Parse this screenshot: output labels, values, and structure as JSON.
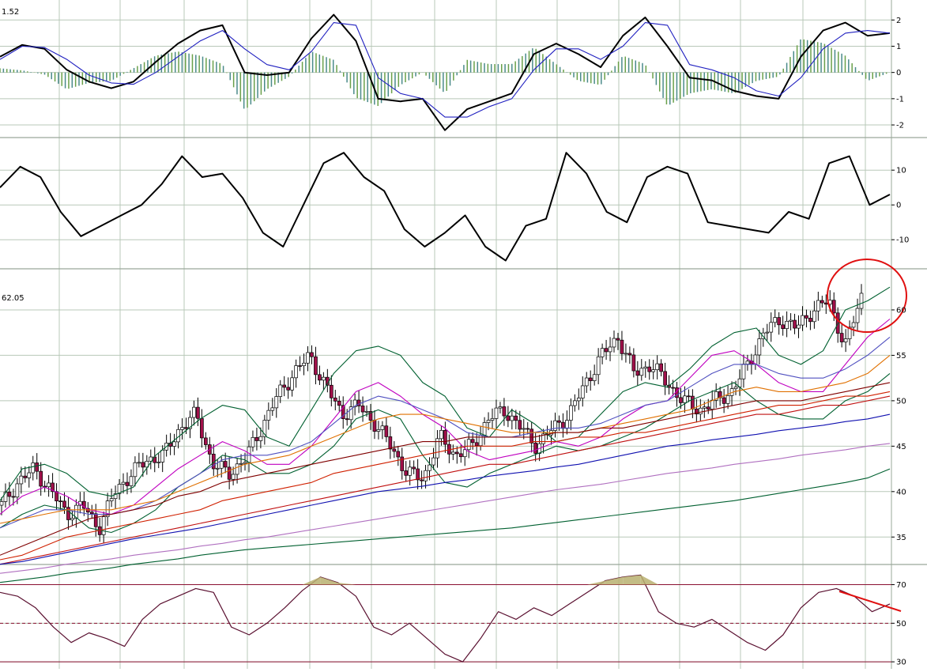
{
  "chart_data": [
    {
      "type": "line",
      "panel": "macd",
      "readout": "1.52",
      "yticks": [
        2,
        1,
        0,
        -1,
        -2
      ],
      "ylim": [
        -2.3,
        2.4
      ],
      "series": [
        {
          "kind": "macd",
          "color": "#000000",
          "values": [
            0.6,
            1.05,
            0.9,
            0.1,
            -0.35,
            -0.6,
            -0.35,
            0.4,
            1.1,
            1.6,
            1.8,
            0.0,
            -0.1,
            0.0,
            1.3,
            2.2,
            1.2,
            -1.0,
            -1.1,
            -1.0,
            -2.2,
            -1.4,
            -1.1,
            -0.8,
            0.7,
            1.1,
            0.7,
            0.2,
            1.4,
            2.1,
            1.0,
            -0.2,
            -0.3,
            -0.7,
            -0.9,
            -1.0,
            0.6,
            1.6,
            1.9,
            1.4,
            1.5
          ]
        },
        {
          "kind": "signal",
          "color": "#2020c0",
          "values": [
            0.5,
            1.0,
            0.95,
            0.5,
            -0.1,
            -0.4,
            -0.45,
            0.0,
            0.6,
            1.2,
            1.6,
            0.9,
            0.3,
            0.1,
            0.8,
            1.9,
            1.8,
            -0.2,
            -0.8,
            -1.0,
            -1.7,
            -1.7,
            -1.3,
            -1.0,
            0.1,
            0.9,
            0.9,
            0.5,
            1.0,
            1.9,
            1.8,
            0.3,
            0.1,
            -0.2,
            -0.7,
            -0.9,
            -0.2,
            0.9,
            1.5,
            1.6,
            1.5
          ]
        }
      ]
    },
    {
      "type": "line",
      "panel": "momentum",
      "yticks": [
        10,
        0,
        -10
      ],
      "ylim": [
        -17,
        18
      ],
      "series": [
        {
          "kind": "oscillator",
          "color": "#000000",
          "values": [
            5,
            11,
            8,
            -2,
            -9,
            -6,
            -3,
            0,
            6,
            14,
            8,
            9,
            2,
            -8,
            -12,
            0,
            12,
            15,
            8,
            4,
            -7,
            -12,
            -8,
            -3,
            -12,
            -16,
            -6,
            -4,
            15,
            9,
            -2,
            -5,
            8,
            11,
            9,
            -5,
            -6,
            -7,
            -8,
            -2,
            -4,
            12,
            14,
            0,
            3
          ]
        }
      ]
    },
    {
      "type": "line",
      "panel": "price",
      "last_price_label": "62.05",
      "yticks": [
        60,
        55,
        50,
        45,
        40,
        35
      ],
      "ylim": [
        32.5,
        64
      ],
      "series": [
        {
          "kind": "candles-close",
          "color": "#000000",
          "values": [
            38.5,
            41,
            42.5,
            40.2,
            37.5,
            38.5,
            36,
            40,
            42,
            43.5,
            44,
            47,
            48.5,
            43,
            42,
            43.5,
            47,
            50.5,
            53,
            55,
            51.5,
            48.5,
            49.5,
            47.5,
            45,
            42,
            41.5,
            46,
            44,
            45,
            48,
            49,
            47,
            45,
            47,
            48.5,
            52,
            55,
            57,
            53,
            54,
            52,
            50,
            49,
            50,
            51,
            54,
            57.5,
            59,
            58,
            60,
            61,
            56,
            61.5
          ]
        },
        {
          "kind": "bollinger-upper",
          "color": "#006030",
          "values": [
            39,
            42.5,
            43,
            42,
            40,
            39.5,
            40.5,
            44,
            46,
            48,
            49.5,
            49,
            46,
            45,
            49,
            53,
            55.5,
            56,
            55,
            52,
            50.5,
            47,
            46,
            49,
            47.5,
            45.5,
            46,
            48.5,
            51,
            52,
            51.5,
            53.5,
            56,
            57.5,
            58,
            55,
            54,
            55.5,
            60,
            61,
            62.5
          ]
        },
        {
          "kind": "bollinger-lower",
          "color": "#006030",
          "values": [
            36,
            37.5,
            38.5,
            38,
            36,
            35.5,
            36.5,
            38,
            40.5,
            42,
            44,
            43.5,
            42,
            42,
            43,
            45,
            48,
            49,
            48,
            44,
            41,
            40.5,
            42,
            43,
            44,
            45,
            44.5,
            45,
            46,
            47,
            48.5,
            50,
            51,
            52,
            50,
            48.5,
            48,
            48,
            50,
            51,
            53
          ]
        },
        {
          "kind": "ema-short",
          "color": "#c000c0",
          "values": [
            37.5,
            39.5,
            40.5,
            39.5,
            38,
            37.5,
            38.5,
            40.5,
            42.5,
            44,
            45.5,
            44.5,
            43,
            43,
            45,
            48,
            51,
            52,
            50.5,
            48.5,
            47,
            44.5,
            43.5,
            44,
            44.5,
            45.5,
            45,
            46,
            48,
            49.5,
            50,
            52.5,
            55,
            55.5,
            54,
            52,
            51,
            51,
            54,
            57,
            59
          ]
        },
        {
          "kind": "ema-mid",
          "color": "#5050c0",
          "values": [
            36,
            37,
            38,
            38,
            37.5,
            37.5,
            38,
            39,
            40.5,
            42,
            43.5,
            44,
            44,
            44.5,
            45.5,
            47.5,
            49.5,
            50.5,
            50,
            49,
            48,
            46.5,
            46,
            46,
            46.5,
            47,
            47,
            47.5,
            48.5,
            49.5,
            50,
            51.5,
            53,
            54,
            54,
            53,
            52.5,
            52.5,
            53.5,
            55,
            57
          ]
        },
        {
          "kind": "ema-long",
          "color": "#e07000",
          "values": [
            36.5,
            37,
            37.5,
            38,
            38,
            38,
            38.5,
            39,
            40,
            41,
            42,
            43,
            43.5,
            44,
            45,
            46,
            47,
            48,
            48.5,
            48.5,
            48,
            47.5,
            47,
            46.5,
            46.5,
            46.5,
            46.5,
            47,
            47.5,
            48,
            48.5,
            49,
            50,
            51,
            51.5,
            51,
            51,
            51.5,
            52,
            53,
            55
          ]
        },
        {
          "kind": "ma-60",
          "color": "#800000",
          "values": [
            33,
            34,
            35,
            36,
            37,
            37.5,
            38,
            38.5,
            39.5,
            40,
            41,
            41.5,
            42,
            42.5,
            43,
            43.5,
            44,
            44.5,
            45,
            45.5,
            45.5,
            46,
            46,
            46,
            46,
            46.5,
            46.5,
            47,
            47,
            47.5,
            48,
            48.5,
            49,
            49.5,
            50,
            50,
            50,
            50.5,
            51,
            51.5,
            52
          ]
        },
        {
          "kind": "ma-80",
          "color": "#d02000",
          "values": [
            32.5,
            33,
            34,
            35,
            35.5,
            36,
            36.5,
            37,
            37.5,
            38,
            39,
            39.5,
            40,
            40.5,
            41,
            42,
            42.5,
            43,
            43.5,
            44,
            44.5,
            45,
            45,
            45,
            45.5,
            45.5,
            46,
            46,
            46.5,
            46.5,
            47,
            47.5,
            48,
            48.5,
            49,
            49.5,
            49.5,
            50,
            50.5,
            50.5,
            51
          ]
        },
        {
          "kind": "ma-100",
          "color": "#c01010",
          "values": [
            32,
            32.5,
            33,
            33.5,
            34,
            34.5,
            35,
            35.5,
            36,
            36.5,
            37,
            37.5,
            38,
            38.5,
            39,
            39.5,
            40,
            40.5,
            41,
            41.5,
            42,
            42.5,
            43,
            43,
            43.5,
            44,
            44.5,
            45,
            45.5,
            46,
            46.5,
            47,
            47.5,
            48,
            48.5,
            48.5,
            49,
            49.5,
            49.5,
            50,
            50.5
          ]
        },
        {
          "kind": "ma-150",
          "color": "#1010b0",
          "values": [
            32,
            32.3,
            32.8,
            33.3,
            33.8,
            34.3,
            34.8,
            35.2,
            35.6,
            36,
            36.5,
            37,
            37.5,
            38,
            38.5,
            39,
            39.5,
            40,
            40.3,
            40.6,
            41,
            41.3,
            41.7,
            42,
            42.3,
            42.7,
            43,
            43.5,
            44,
            44.5,
            45,
            45.3,
            45.7,
            46,
            46.3,
            46.7,
            47,
            47.3,
            47.7,
            48,
            48.5
          ]
        },
        {
          "kind": "ma-200",
          "color": "#b070c0",
          "values": [
            31,
            31.3,
            31.6,
            32,
            32.3,
            32.6,
            33,
            33.3,
            33.6,
            34,
            34.3,
            34.7,
            35,
            35.4,
            35.8,
            36.2,
            36.6,
            37,
            37.4,
            37.8,
            38.2,
            38.6,
            39,
            39.4,
            39.8,
            40.2,
            40.5,
            40.8,
            41.2,
            41.6,
            42,
            42.3,
            42.6,
            43,
            43.3,
            43.6,
            44,
            44.3,
            44.6,
            45,
            45.3
          ]
        },
        {
          "kind": "ma-250",
          "color": "#006030",
          "values": [
            30,
            30.3,
            30.6,
            31,
            31.3,
            31.6,
            32,
            32.3,
            32.6,
            33,
            33.3,
            33.6,
            33.8,
            34,
            34.2,
            34.4,
            34.6,
            34.8,
            35,
            35.2,
            35.4,
            35.6,
            35.8,
            36,
            36.3,
            36.6,
            36.9,
            37.2,
            37.5,
            37.8,
            38.1,
            38.4,
            38.7,
            39,
            39.4,
            39.8,
            40.2,
            40.6,
            41,
            41.5,
            42.5
          ]
        }
      ]
    },
    {
      "type": "line",
      "panel": "rsi",
      "yticks": [
        70,
        50,
        30
      ],
      "ylim": [
        28,
        78
      ],
      "reference_lines": [
        70,
        50,
        30
      ],
      "overbought_fill_color": "#b8b070",
      "series": [
        {
          "kind": "rsi",
          "color": "#5a1030",
          "values": [
            66,
            64,
            58,
            48,
            40,
            45,
            42,
            38,
            52,
            60,
            64,
            68,
            66,
            48,
            44,
            50,
            58,
            67,
            74,
            71,
            64,
            48,
            44,
            50,
            42,
            34,
            30,
            42,
            56,
            52,
            58,
            54,
            60,
            66,
            72,
            74,
            75,
            56,
            50,
            48,
            52,
            46,
            40,
            36,
            44,
            58,
            66,
            68,
            64,
            56,
            60
          ]
        }
      ]
    }
  ],
  "annotations": {
    "circle_color": "#e01010",
    "divergence_line_color": "#e01010"
  }
}
